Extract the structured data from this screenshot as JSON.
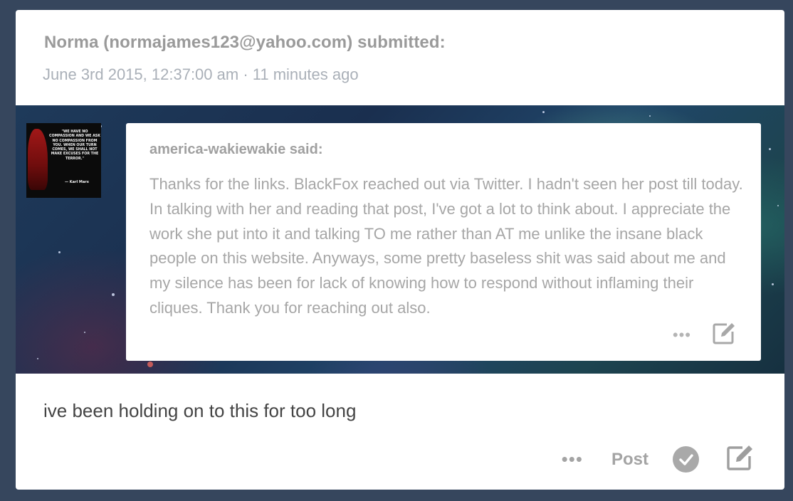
{
  "submission": {
    "submitter": "Norma (normajames123@yahoo.com) submitted:",
    "timestamp": "June 3rd 2015, 12:37:00 am · 11 minutes ago"
  },
  "quoted_post": {
    "author": "america-wakiewakie said:",
    "body": "Thanks for the links. BlackFox reached out via Twitter. I hadn't seen her post till today. In talking with her and reading that post, I've got a lot to think about. I appreciate the work she put into it and talking TO me rather than AT me unlike the insane black people on this website. Anyways, some pretty baseless shit was said about me and my silence has been for lack of knowing how to respond without inflaming their cliques. Thank you for reaching out also.",
    "more_label": "•••",
    "edit_icon": "edit-icon",
    "avatar": {
      "quote": "\"We have no compassion and we ask no compassion from you. When our turn comes, we shall not make excuses for the terror.\"",
      "author": "— Karl Marx"
    }
  },
  "comment": "ive been holding on to this for too long",
  "footer": {
    "more_label": "•••",
    "post_label": "Post",
    "approve_icon": "check-circle-icon",
    "edit_icon": "edit-icon"
  },
  "colors": {
    "page_background": "#36465d",
    "card_background": "#ffffff"
  }
}
